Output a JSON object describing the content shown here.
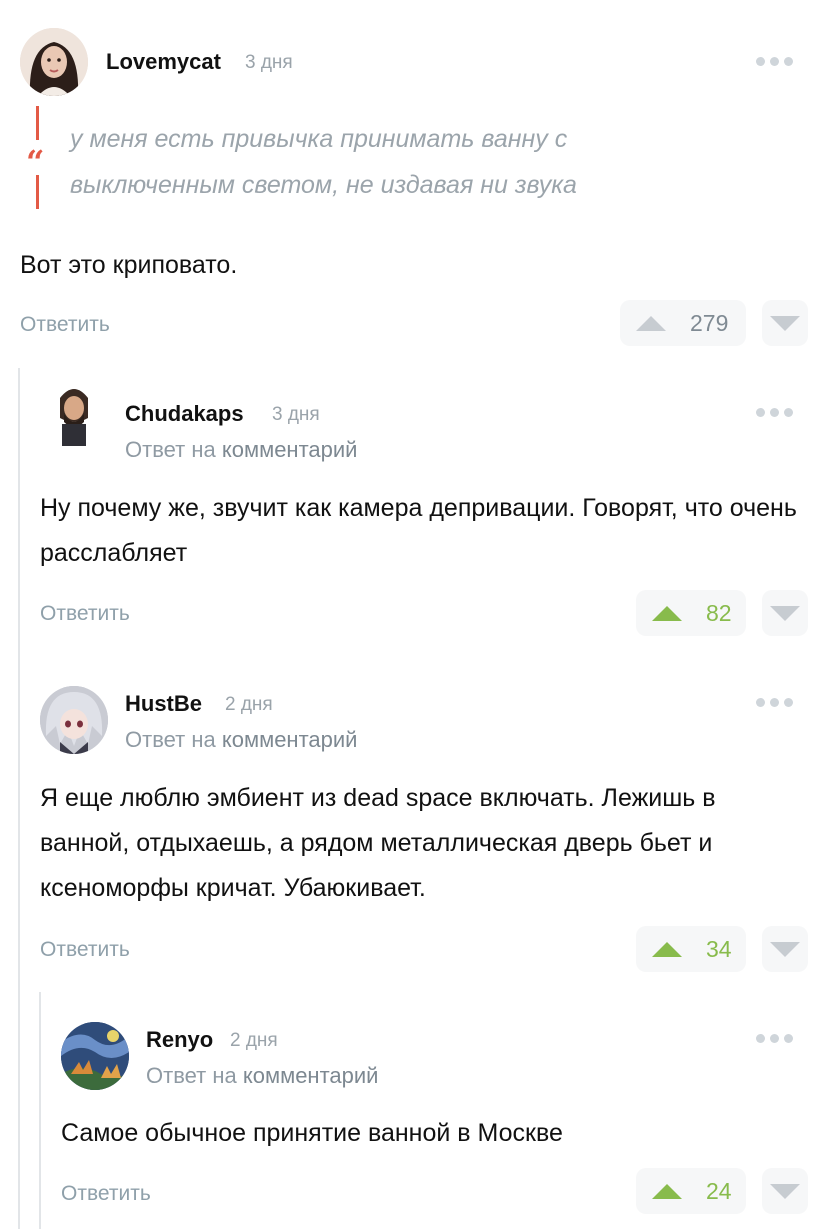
{
  "comments": [
    {
      "author": "Lovemycat",
      "time": "3 дня",
      "quote": "у меня есть привычка принимать ванну с выключенным светом, не издавая ни звука",
      "text": "Вот это криповато.",
      "reply_label": "Ответить",
      "votes": "279"
    },
    {
      "author": "Chudakaps",
      "time": "3 дня",
      "reply_to_prefix": "Ответ на",
      "reply_to_link": "комментарий",
      "text": "Ну почему же, звучит как камера депривации. Говорят, что очень расслабляет",
      "reply_label": "Ответить",
      "votes": "82"
    },
    {
      "author": "HustBe",
      "time": "2 дня",
      "reply_to_prefix": "Ответ на",
      "reply_to_link": "комментарий",
      "text": "Я еще люблю эмбиент из dead space включать. Лежишь в ванной, отдыхаешь, а рядом металлическая дверь бьет и ксеноморфы кричат. Убаюкивает.",
      "reply_label": "Ответить",
      "votes": "34"
    },
    {
      "author": "Renyo",
      "time": "2 дня",
      "reply_to_prefix": "Ответ на",
      "reply_to_link": "комментарий",
      "text": "Самое обычное принятие ванной в Москве",
      "reply_label": "Ответить",
      "votes": "24"
    }
  ],
  "colors": {
    "accent_positive": "#88bb4c",
    "quote_accent": "#e35a46",
    "muted_text": "#8fa0aa"
  },
  "icons": [
    "more-options-icon",
    "upvote-icon",
    "downvote-icon",
    "quote-icon"
  ]
}
